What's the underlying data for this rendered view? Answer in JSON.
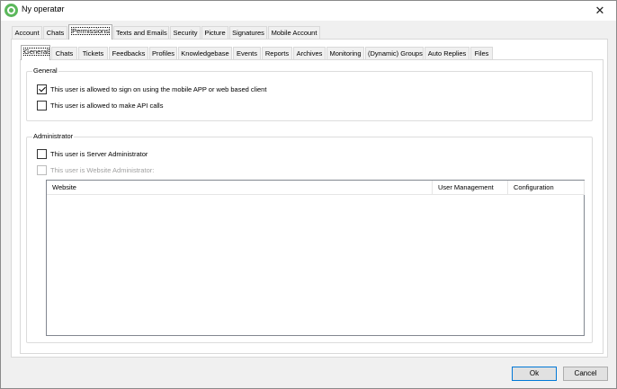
{
  "window": {
    "title": "Ny operatør",
    "close_glyph": "✕",
    "icon": "app-logo-icon"
  },
  "outer_tabs": [
    {
      "label": "Account"
    },
    {
      "label": "Chats"
    },
    {
      "label": "Permissions"
    },
    {
      "label": "Texts and Emails"
    },
    {
      "label": "Security"
    },
    {
      "label": "Picture"
    },
    {
      "label": "Signatures"
    },
    {
      "label": "Mobile Account"
    }
  ],
  "inner_tabs": [
    {
      "label": "General"
    },
    {
      "label": "Chats"
    },
    {
      "label": "Tickets"
    },
    {
      "label": "Feedbacks"
    },
    {
      "label": "Profiles"
    },
    {
      "label": "Knowledgebase"
    },
    {
      "label": "Events"
    },
    {
      "label": "Reports"
    },
    {
      "label": "Archives"
    },
    {
      "label": "Monitoring"
    },
    {
      "label": "(Dynamic) Groups"
    },
    {
      "label": "Auto Replies"
    },
    {
      "label": "Files"
    }
  ],
  "general_group": {
    "legend": "General",
    "mobile_login": {
      "label": "This user is allowed to sign on using the mobile APP or web based client",
      "checked": true
    },
    "api_calls": {
      "label": "This user is allowed to make API calls",
      "checked": false
    }
  },
  "administrator_group": {
    "legend": "Administrator",
    "server_admin": {
      "label": "This user is Server Administrator",
      "checked": false
    },
    "website_admin": {
      "label": "This user is Website Administrator:",
      "checked": false,
      "disabled": true
    },
    "columns": [
      "Website",
      "User Management",
      "Configuration"
    ]
  },
  "buttons": {
    "ok": "Ok",
    "cancel": "Cancel"
  }
}
